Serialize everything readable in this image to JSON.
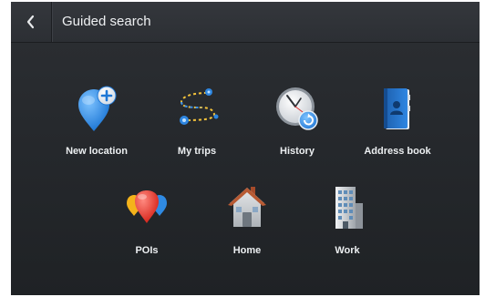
{
  "header": {
    "title": "Guided search"
  },
  "icons": {
    "back": "chevron-left-icon"
  },
  "tiles": [
    {
      "label": "New location"
    },
    {
      "label": "My trips"
    },
    {
      "label": "History"
    },
    {
      "label": "Address book"
    },
    {
      "label": "POIs"
    },
    {
      "label": "Home"
    },
    {
      "label": "Work"
    }
  ]
}
